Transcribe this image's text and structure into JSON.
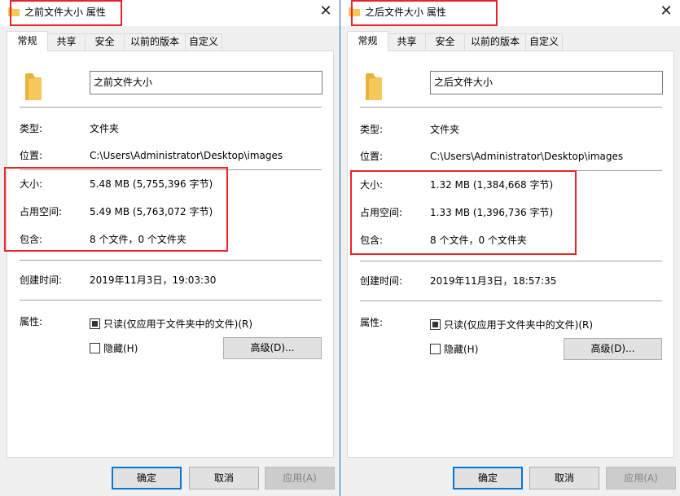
{
  "dialogs": [
    {
      "title": "之前文件大小 属性",
      "tabs": [
        "常规",
        "共享",
        "安全",
        "以前的版本",
        "自定义"
      ],
      "name_value": "之前文件大小",
      "type_label": "类型:",
      "type_value": "文件夹",
      "location_label": "位置:",
      "location_value": "C:\\Users\\Administrator\\Desktop\\images",
      "size_label": "大小:",
      "size_value": "5.48 MB (5,755,396 字节)",
      "size_on_disk_label": "占用空间:",
      "size_on_disk_value": "5.49 MB (5,763,072 字节)",
      "contains_label": "包含:",
      "contains_value": "8 个文件，0 个文件夹",
      "created_label": "创建时间:",
      "created_value": "2019年11月3日，19:03:30",
      "attributes_label": "属性:",
      "readonly_label": "只读(仅应用于文件夹中的文件)(R)",
      "hidden_label": "隐藏(H)",
      "advanced_label": "高级(D)...",
      "ok_label": "确定",
      "cancel_label": "取消",
      "apply_label": "应用(A)"
    },
    {
      "title": "之后文件大小 属性",
      "tabs": [
        "常规",
        "共享",
        "安全",
        "以前的版本",
        "自定义"
      ],
      "name_value": "之后文件大小",
      "type_label": "类型:",
      "type_value": "文件夹",
      "location_label": "位置:",
      "location_value": "C:\\Users\\Administrator\\Desktop\\images",
      "size_label": "大小:",
      "size_value": "1.32 MB (1,384,668 字节)",
      "size_on_disk_label": "占用空间:",
      "size_on_disk_value": "1.33 MB (1,396,736 字节)",
      "contains_label": "包含:",
      "contains_value": "8 个文件，0 个文件夹",
      "created_label": "创建时间:",
      "created_value": "2019年11月3日，18:57:35",
      "attributes_label": "属性:",
      "readonly_label": "只读(仅应用于文件夹中的文件)(R)",
      "hidden_label": "隐藏(H)",
      "advanced_label": "高级(D)...",
      "ok_label": "确定",
      "cancel_label": "取消",
      "apply_label": "应用(A)"
    }
  ],
  "icons": {
    "folder": "folder-icon",
    "close": "close-icon"
  },
  "colors": {
    "highlight": "#e8242a",
    "accent": "#0078d7",
    "folder": "#f6c75a"
  }
}
